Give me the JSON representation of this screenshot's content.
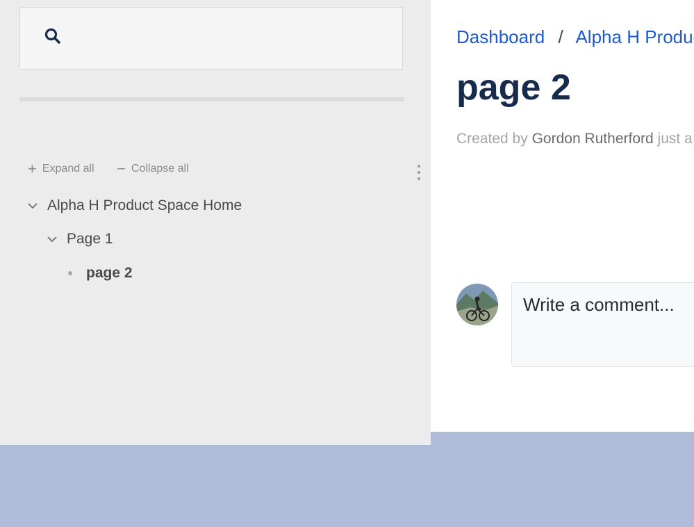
{
  "search": {
    "placeholder": ""
  },
  "tree_actions": {
    "expand_label": "Expand all",
    "collapse_label": "Collapse all"
  },
  "tree": [
    {
      "label": "Alpha H Product Space Home",
      "expanded": true
    },
    {
      "label": "Page 1",
      "expanded": true
    },
    {
      "label": "page 2",
      "current": true
    }
  ],
  "breadcrumb": {
    "items": [
      "Dashboard",
      "Alpha H Produc"
    ],
    "separator": "/"
  },
  "page": {
    "title": "page 2",
    "created_by_prefix": "Created by",
    "author": "Gordon Rutherford",
    "time": "just a"
  },
  "comment": {
    "placeholder": "Write a comment..."
  },
  "colors": {
    "link": "#1d59d1",
    "title": "#172b4d",
    "sidebar_bg": "#ececec",
    "footer_bg": "#aebbd9"
  }
}
